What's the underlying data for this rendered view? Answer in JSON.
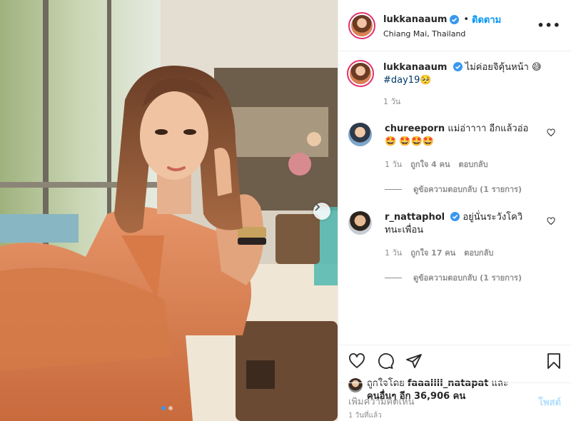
{
  "post": {
    "username": "lukkanaaum",
    "separator": "•",
    "follow_label": "ติดตาม",
    "location": "Chiang Mai, Thailand",
    "more_label": "•••"
  },
  "caption": {
    "username": "lukkanaaum",
    "text": "ไม่ค่อยจิคุ้นหน้า 😅",
    "hashtag": "#day19",
    "hashtag_emoji": "🥺",
    "time": "1 วัน"
  },
  "comments": [
    {
      "username": "chureeporn",
      "text": "แม่อ่าาาา อีกแล้วอ่อ🤩 🤩🤩🤩",
      "time": "1 วัน",
      "likes": "ถูกใจ 4 คน",
      "reply_label": "ตอบกลับ",
      "view_replies": "ดูข้อความตอบกลับ (1 รายการ)"
    },
    {
      "username": "r_nattaphol",
      "text": "อยู่นั่นระวังโควิทนะเพื่อน",
      "time": "1 วัน",
      "likes": "ถูกใจ 17 คน",
      "reply_label": "ตอบกลับ",
      "view_replies": "ดูข้อความตอบกลับ (1 รายการ)"
    }
  ],
  "likes": {
    "prefix": "ถูกใจโดย",
    "user": "faaaiiii_natapat",
    "conj": "และ",
    "others": "คนอื่นๆ อีก 36,906 คน"
  },
  "timestamp": "1 วันที่แล้ว",
  "add_comment": {
    "placeholder": "เพิ่มความคิดเห็น",
    "post_label": "โพสต์"
  },
  "carousel": {
    "count": 2,
    "active_index": 0
  },
  "colors": {
    "accent": "#0095f6",
    "verified": "#3897f0",
    "post_disabled": "#b2dffc"
  },
  "icons": [
    "verified-badge-icon",
    "more-icon",
    "heart-icon",
    "comment-icon",
    "share-icon",
    "bookmark-icon",
    "chevron-right-icon"
  ]
}
